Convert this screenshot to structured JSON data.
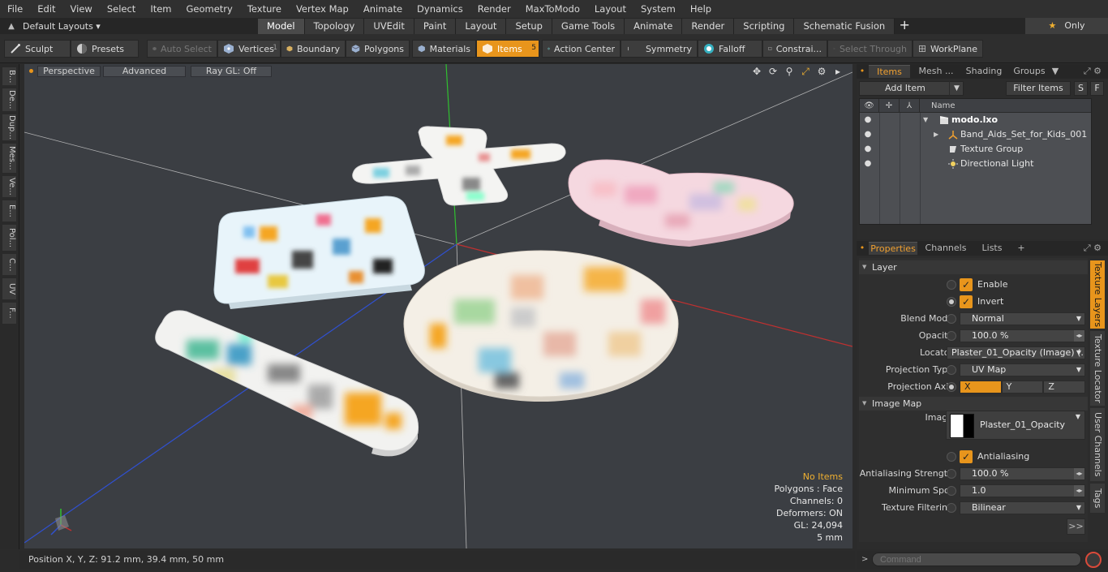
{
  "menu": [
    "File",
    "Edit",
    "View",
    "Select",
    "Item",
    "Geometry",
    "Texture",
    "Vertex Map",
    "Animate",
    "Dynamics",
    "Render",
    "MaxToModo",
    "Layout",
    "System",
    "Help"
  ],
  "layout_bar": {
    "layout_name": "Default Layouts ▾",
    "tabs": [
      "Model",
      "Topology",
      "UVEdit",
      "Paint",
      "Layout",
      "Setup",
      "Game Tools",
      "Animate",
      "Render",
      "Scripting",
      "Schematic Fusion"
    ],
    "active_tab": "Model",
    "only_label": "Only"
  },
  "toolbar": {
    "sculpt": "Sculpt",
    "presets": "Presets",
    "auto_select": "Auto Select",
    "vertices": "Vertices",
    "vertices_count": "1",
    "boundary": "Boundary",
    "polygons": "Polygons",
    "materials": "Materials",
    "items": "Items",
    "items_count": "5",
    "action_center": "Action Center",
    "symmetry": "Symmetry",
    "falloff": "Falloff",
    "constraints": "Constrai...",
    "select_through": "Select Through",
    "workplane": "WorkPlane"
  },
  "left_tabs": [
    "B...",
    "De...",
    "Dup...",
    "Mes...",
    "Ve...",
    "E...",
    "Pol...",
    "C...",
    "UV",
    "F..."
  ],
  "viewport": {
    "perspective": "Perspective",
    "advanced": "Advanced",
    "raygl": "Ray GL: Off",
    "info": {
      "selection": "No Items",
      "polygons": "Polygons : Face",
      "channels": "Channels: 0",
      "deformers": "Deformers: ON",
      "gl": "GL: 24,094",
      "scale": "5 mm"
    }
  },
  "status": {
    "position": "Position X, Y, Z:  91.2 mm, 39.4 mm, 50 mm"
  },
  "items_panel": {
    "tabs": [
      "Items",
      "Mesh ...",
      "Shading",
      "Groups"
    ],
    "active_tab": "Items",
    "add_item": "Add Item",
    "filter_items": "Filter Items",
    "s_btn": "S",
    "f_btn": "F",
    "col_name": "Name",
    "rows": [
      {
        "label": "modo.lxo"
      },
      {
        "label": "Band_Aids_Set_for_Kids_001"
      },
      {
        "label": "Texture Group"
      },
      {
        "label": "Directional Light"
      }
    ]
  },
  "properties_panel": {
    "tabs": [
      "Properties",
      "Channels",
      "Lists"
    ],
    "active_tab": "Properties",
    "layer_section": "Layer",
    "enable": "Enable",
    "invert": "Invert",
    "blend_mode_label": "Blend Mode",
    "blend_mode": "Normal",
    "opacity_label": "Opacity",
    "opacity": "100.0 %",
    "locator_label": "Locator",
    "locator": "Plaster_01_Opacity (Image) (...",
    "projection_type_label": "Projection Type",
    "projection_type": "UV Map",
    "projection_axis_label": "Projection Axis",
    "axis_x": "X",
    "axis_y": "Y",
    "axis_z": "Z",
    "image_map_section": "Image Map",
    "image_label": "Image",
    "image_name": "Plaster_01_Opacity",
    "antialiasing": "Antialiasing",
    "aa_strength_label": "Antialiasing Strength",
    "aa_strength": "100.0 %",
    "min_spot_label": "Minimum Spot",
    "min_spot": "1.0",
    "tex_filter_label": "Texture Filtering",
    "tex_filter": "Bilinear",
    "more": ">>",
    "side_tabs": [
      "Texture Layers",
      "Texture Locator",
      "User Channels",
      "Tags"
    ]
  },
  "command": {
    "placeholder": "Command"
  },
  "colors": {
    "accent": "#e8951c",
    "viewport_bg": "#3b3e43",
    "axis_x": "#c03030",
    "axis_y": "#30c030",
    "axis_z": "#3050d0"
  }
}
